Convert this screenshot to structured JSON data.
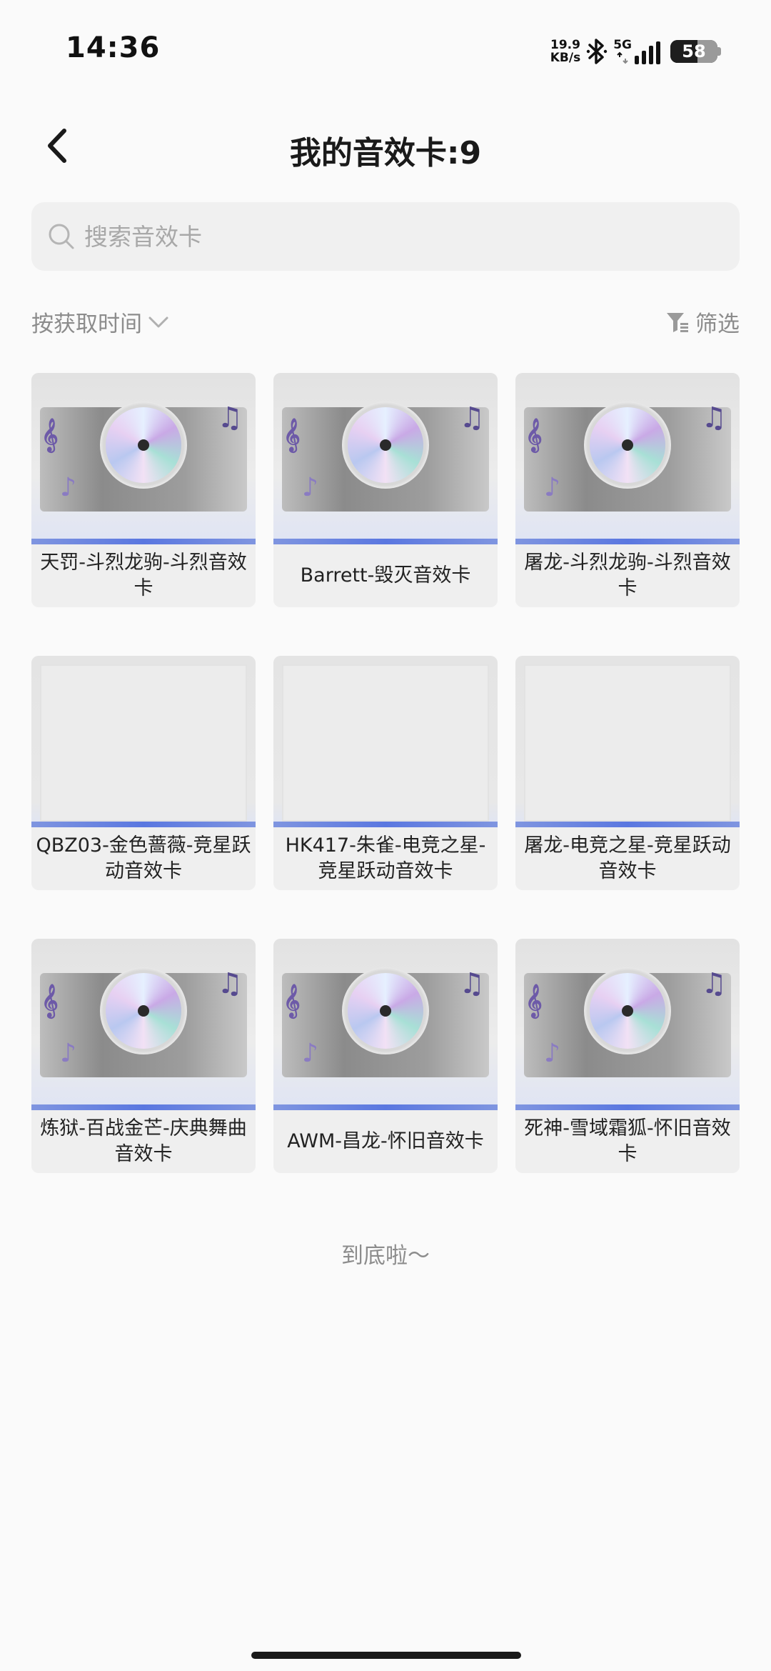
{
  "status_bar": {
    "time": "14:36",
    "net_speed_value": "19.9",
    "net_speed_unit": "KB/s",
    "network": "5G",
    "battery": "58",
    "battery_level": 0.58
  },
  "header": {
    "back_icon": "chevron-left-icon",
    "title": "我的音效卡:9"
  },
  "search": {
    "placeholder": "搜索音效卡",
    "value": "",
    "icon": "search-icon"
  },
  "toolbar": {
    "sort_label": "按获取时间",
    "sort_icon": "chevron-down-icon",
    "filter_label": "筛选",
    "filter_icon": "filter-icon"
  },
  "cards": [
    {
      "label": "天罚-斗烈龙驹-斗烈音效卡",
      "art": "disc"
    },
    {
      "label": "Barrett-毁灭音效卡",
      "art": "disc"
    },
    {
      "label": "屠龙-斗烈龙驹-斗烈音效卡",
      "art": "disc"
    },
    {
      "label": "QBZ03-金色蔷薇-竞星跃动音效卡",
      "art": "blank"
    },
    {
      "label": "HK417-朱雀-电竞之星-竞星跃动音效卡",
      "art": "blank"
    },
    {
      "label": "屠龙-电竞之星-竞星跃动音效卡",
      "art": "blank"
    },
    {
      "label": "炼狱-百战金芒-庆典舞曲音效卡",
      "art": "disc"
    },
    {
      "label": "AWM-昌龙-怀旧音效卡",
      "art": "disc"
    },
    {
      "label": "死神-雪域霜狐-怀旧音效卡",
      "art": "disc"
    }
  ],
  "footer": {
    "end_text": "到底啦～"
  },
  "colors": {
    "background": "#fafafa",
    "card_bg": "#efefef",
    "accent_stripe": "#5a77e0",
    "muted_text": "#8c8c8c"
  }
}
